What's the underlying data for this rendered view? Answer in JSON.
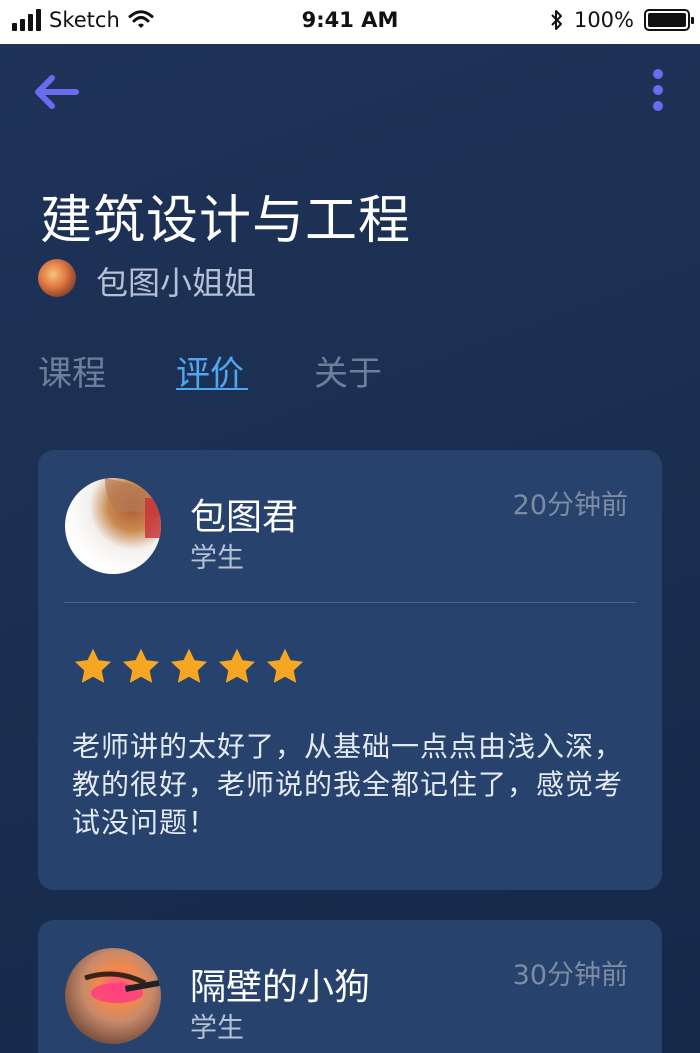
{
  "status_bar": {
    "carrier": "Sketch",
    "time": "9:41 AM",
    "battery": "100%"
  },
  "course": {
    "title": "建筑设计与工程",
    "author": "包图小姐姐"
  },
  "tabs": [
    {
      "label": "课程",
      "active": false
    },
    {
      "label": "评价",
      "active": true
    },
    {
      "label": "关于",
      "active": false
    }
  ],
  "reviews": [
    {
      "name": "包图君",
      "role": "学生",
      "time": "20分钟前",
      "rating": 5,
      "text": "老师讲的太好了，从基础一点点由浅入深，教的很好，老师说的我全都记住了，感觉考试没问题！"
    },
    {
      "name": "隔壁的小狗",
      "role": "学生",
      "time": "30分钟前"
    }
  ],
  "colors": {
    "accent": "#4ea7f0",
    "back_icon": "#6a6cf0",
    "star": "#f5a623",
    "card": "#27436d"
  }
}
